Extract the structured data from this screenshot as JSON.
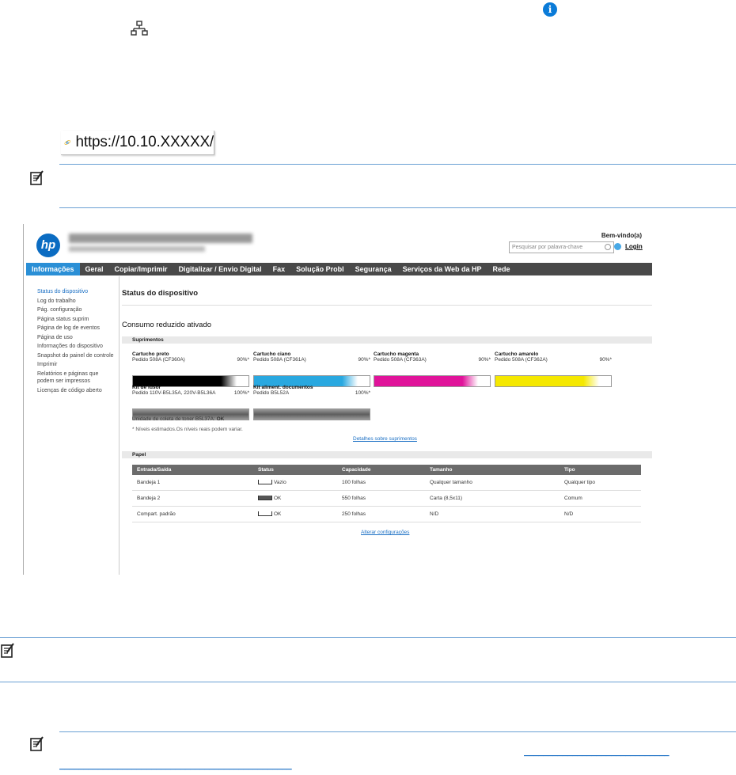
{
  "url": "https://10.10.XXXXX/",
  "bottom_link": {
    "line1": "______________________________",
    "line2": "________________________________________________"
  },
  "ews": {
    "brand": "hp",
    "welcome": "Bem-vindo(a)",
    "search_placeholder": "Pesquisar por palavra-chave",
    "login": "Login",
    "nav": [
      "Informações",
      "Geral",
      "Copiar/Imprimir",
      "Digitalizar / Envio Digital",
      "Fax",
      "Solução Probl",
      "Segurança",
      "Serviços da Web da HP",
      "Rede"
    ],
    "sidebar": [
      "Status do dispositivo",
      "Log do trabalho",
      "Pág. configuração",
      "Página status suprim",
      "Página de log de eventos",
      "Página de uso",
      "Informações do dispositivo",
      "Snapshot do painel de controle",
      "Imprimir",
      "Relatórios e páginas que",
      "podem ser impressos",
      "Licenças de código aberto"
    ],
    "page_title": "Status do dispositivo",
    "eco_mode": "Consumo reduzido ativado",
    "supplies_title": "Suprimentos",
    "supplies": [
      {
        "name": "Cartucho preto",
        "order": "Pedido 508A (CF360A)",
        "pct": "90%*",
        "level": 0.9,
        "color": "#000000"
      },
      {
        "name": "Cartucho ciano",
        "order": "Pedido 508A (CF361A)",
        "pct": "90%*",
        "level": 0.9,
        "color": "#29a8e0"
      },
      {
        "name": "Cartucho magenta",
        "order": "Pedido 508A (CF363A)",
        "pct": "90%*",
        "level": 0.9,
        "color": "#e0139a"
      },
      {
        "name": "Cartucho amarelo",
        "order": "Pedido 508A (CF362A)",
        "pct": "90%*",
        "level": 0.9,
        "color": "#f5e800"
      },
      {
        "name": "Kit de fusor",
        "order": "Pedido 110V-B5L35A, 220V-B5L36A",
        "pct": "100%*",
        "level": 1.0,
        "color": "#7a7a7a"
      },
      {
        "name": "Kit aliment. documentos",
        "order": "Pedido B5L52A",
        "pct": "100%*",
        "level": 1.0,
        "color": "#7a7a7a"
      }
    ],
    "toner_unit_label": "Unidade de coleta de toner B5L37A:",
    "toner_unit_status": "OK",
    "estimate_note": "* Níveis estimados.Os níveis reais podem variar.",
    "supplies_link": "Detalhes sobre suprimentos",
    "paper_title": "Papel",
    "paper_headers": [
      "Entrada/Saída",
      "Status",
      "Capacidade",
      "Tamanho",
      "Tipo"
    ],
    "paper_rows": [
      [
        "Bandeja 1",
        "Vazio",
        "100 folhas",
        "Qualquer tamanho",
        "Qualquer tipo"
      ],
      [
        "Bandeja 2",
        "OK",
        "550 folhas",
        "Carta (8,5x11)",
        "Comum"
      ],
      [
        "Compart. padrão",
        "OK",
        "250 folhas",
        "N/D",
        "N/D"
      ]
    ],
    "paper_link": "Alterar configurações"
  }
}
